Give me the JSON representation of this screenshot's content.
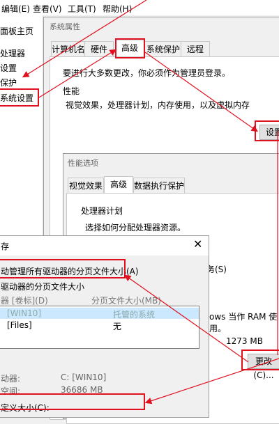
{
  "menubar": {
    "edit": "编辑(E)",
    "view": "查看(V)",
    "tools": "工具(T)",
    "help": "帮助(H)"
  },
  "left_panel": {
    "items": [
      "面板主页",
      "处理器",
      "设置",
      "保护",
      "系统设置"
    ]
  },
  "sysprops": {
    "title": "系统属性",
    "tabs": [
      "计算机名",
      "硬件",
      "高级",
      "系统保护",
      "远程"
    ],
    "admin_note": "要进行大多数更改，你必须作为管理员登录。",
    "perf_group": "性能",
    "perf_desc": "视觉效果，处理器计划，内存使用，以及虚拟内存",
    "settings_button": "设置"
  },
  "perfopts": {
    "title": "性能选项",
    "tabs": [
      "视觉效果",
      "高级",
      "数据执行保护"
    ],
    "cpu_group": "处理器计划",
    "cpu_desc": "选择如何分配处理器资源。",
    "frag_s": "务(S)",
    "vm_line": "ows 当作 RAM 使用。",
    "vm_size": "1273 MB",
    "change_button": "更改(C)..."
  },
  "vmdialog": {
    "title": "存",
    "auto_label": "动管理所有驱动器的分页文件大小(A)",
    "group_title": "驱动器的分页文件大小",
    "col_drive": "器 [卷标](D)",
    "col_size": "分页文件大小(MB)",
    "rows": [
      {
        "drive": "[WIN10]",
        "size": "托管的系统"
      },
      {
        "drive": "[Files]",
        "size": "无"
      }
    ],
    "selected_drive_label": "动器:",
    "selected_drive_value": "C: [WIN10]",
    "space_label": "空间:",
    "space_value": "36686 MB",
    "custom_label": "定义大小(C):"
  },
  "colors": {
    "highlight": "#e0101f",
    "selection": "#cce8ff"
  }
}
